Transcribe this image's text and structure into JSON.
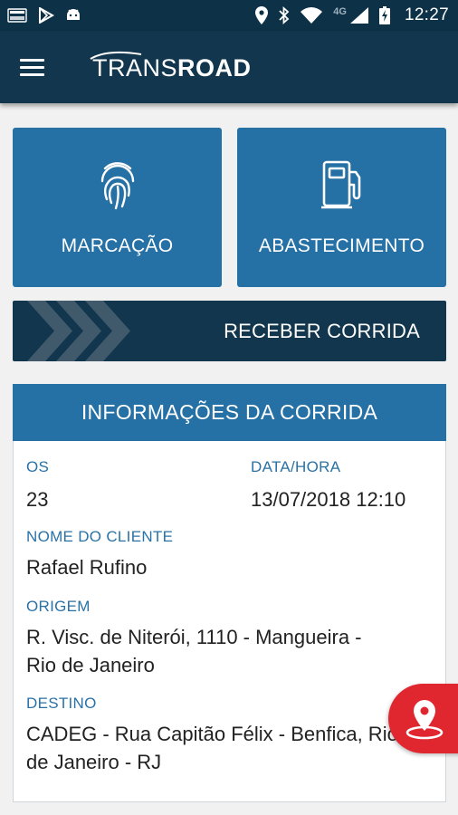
{
  "status_bar": {
    "time": "12:27",
    "network": "4G",
    "icons": [
      "roadmap-icon",
      "play-store-icon",
      "android-icon",
      "location-icon",
      "bluetooth-icon",
      "wifi-icon",
      "signal-icon",
      "battery-charging-icon"
    ]
  },
  "app_bar": {
    "menu_icon": "hamburger-menu-icon",
    "logo_light": "TRANS",
    "logo_bold": "ROAD"
  },
  "tiles": [
    {
      "label": "MARCAÇÃO",
      "icon": "fingerprint-icon"
    },
    {
      "label": "ABASTECIMENTO",
      "icon": "fuel-pump-icon"
    }
  ],
  "receber": {
    "label": "RECEBER CORRIDA",
    "icon": "chevrons-icon"
  },
  "info_card": {
    "title": "INFORMAÇÕES DA CORRIDA",
    "os_label": "OS",
    "os_value": "23",
    "datetime_label": "DATA/HORA",
    "datetime_value": "13/07/2018 12:10",
    "client_label": "NOME DO CLIENTE",
    "client_value": "Rafael Rufino",
    "origin_label": "ORIGEM",
    "origin_line1": "R. Visc. de Niterói, 1110 - Mangueira -",
    "origin_line2": "Rio de Janeiro",
    "dest_label": "DESTINO",
    "dest_line1": "CADEG - Rua Capitão Félix - Benfica, Rio",
    "dest_line2": "de Janeiro - RJ"
  },
  "fab": {
    "icon": "map-pin-icon"
  },
  "colors": {
    "status_bar": "#0d3147",
    "app_bar": "#12364d",
    "tile_blue": "#2570a4",
    "label_blue": "#2a72a6",
    "fab_red": "#e0262f",
    "background": "#f1f1f1"
  }
}
